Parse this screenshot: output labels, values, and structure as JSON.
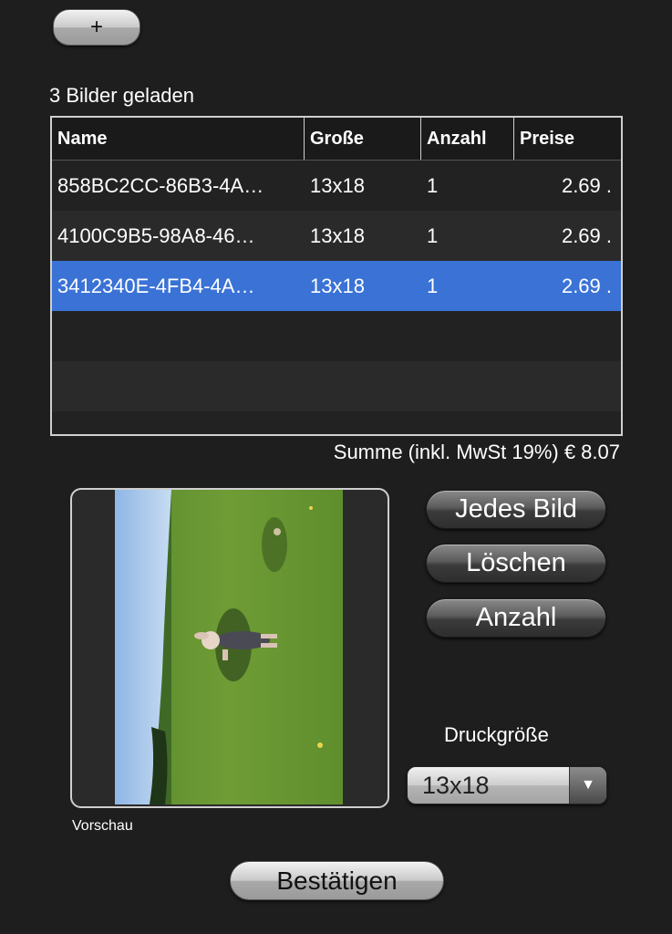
{
  "toolbar": {
    "add_label": "+"
  },
  "status": {
    "loaded_text": "3 Bilder geladen"
  },
  "table": {
    "headers": [
      "Name",
      "Große",
      "Anzahl",
      "Preise"
    ],
    "rows": [
      [
        "858BC2CC-86B3-4A…",
        "13x18",
        "1",
        "2.69 ."
      ],
      [
        "4100C9B5-98A8-46…",
        "13x18",
        "1",
        "2.69 ."
      ],
      [
        "3412340E-4FB4-4A…",
        "13x18",
        "1",
        "2.69 ."
      ]
    ],
    "selected_row": 2
  },
  "total": {
    "text": "Summe (inkl. MwSt 19%) € 8.07"
  },
  "preview": {
    "label": "Vorschau"
  },
  "actions": {
    "each_image": "Jedes Bild",
    "delete": "Löschen",
    "count": "Anzahl"
  },
  "print_size": {
    "label": "Druckgröße",
    "value": "13x18"
  },
  "confirm": {
    "label": "Bestätigen"
  },
  "colors": {
    "selection": "#3a72d6",
    "background": "#1e1e1e"
  }
}
